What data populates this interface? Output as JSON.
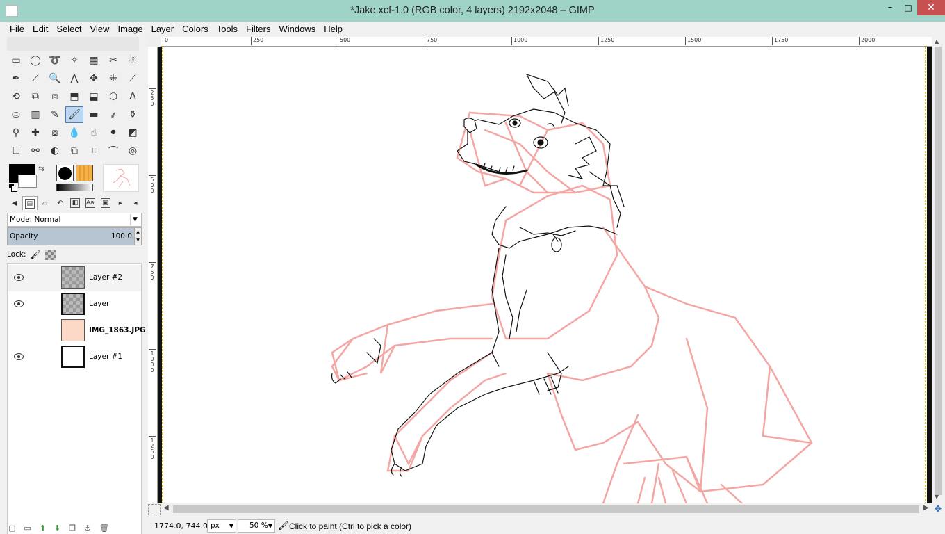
{
  "window": {
    "title": "*Jake.xcf-1.0 (RGB color, 4 layers) 2192x2048 – GIMP",
    "controls": {
      "minimize": "–",
      "maximize": "□",
      "close": "✕"
    }
  },
  "menu": [
    "File",
    "Edit",
    "Select",
    "View",
    "Image",
    "Layer",
    "Colors",
    "Tools",
    "Filters",
    "Windows",
    "Help"
  ],
  "toolbox": {
    "tools": [
      {
        "name": "rect-select-icon",
        "glyph": "▭"
      },
      {
        "name": "ellipse-select-icon",
        "glyph": "◯"
      },
      {
        "name": "free-select-icon",
        "glyph": "➰"
      },
      {
        "name": "fuzzy-select-icon",
        "glyph": "✧"
      },
      {
        "name": "color-select-icon",
        "glyph": "▦"
      },
      {
        "name": "scissors-select-icon",
        "glyph": "✂"
      },
      {
        "name": "foreground-select-icon",
        "glyph": "☃"
      },
      {
        "name": "paths-icon",
        "glyph": "✒"
      },
      {
        "name": "color-picker-icon",
        "glyph": "⟋"
      },
      {
        "name": "zoom-icon",
        "glyph": "🔍"
      },
      {
        "name": "measure-icon",
        "glyph": "⋀"
      },
      {
        "name": "move-icon",
        "glyph": "✥"
      },
      {
        "name": "align-icon",
        "glyph": "⁜"
      },
      {
        "name": "crop-icon",
        "glyph": "⟋"
      },
      {
        "name": "rotate-icon",
        "glyph": "⟲"
      },
      {
        "name": "scale-icon",
        "glyph": "⧉"
      },
      {
        "name": "shear-icon",
        "glyph": "⧈"
      },
      {
        "name": "perspective-icon",
        "glyph": "⬒"
      },
      {
        "name": "flip-icon",
        "glyph": "⬓"
      },
      {
        "name": "cage-icon",
        "glyph": "⬡"
      },
      {
        "name": "text-icon",
        "glyph": "A"
      },
      {
        "name": "bucket-fill-icon",
        "glyph": "⛀"
      },
      {
        "name": "blend-icon",
        "glyph": "▥"
      },
      {
        "name": "pencil-icon",
        "glyph": "✎"
      },
      {
        "name": "paintbrush-icon",
        "glyph": "🖌"
      },
      {
        "name": "eraser-icon",
        "glyph": "▬"
      },
      {
        "name": "airbrush-icon",
        "glyph": "⸙"
      },
      {
        "name": "ink-icon",
        "glyph": "⚱"
      },
      {
        "name": "clone-icon",
        "glyph": "⚲"
      },
      {
        "name": "heal-icon",
        "glyph": "✚"
      },
      {
        "name": "perspective-clone-icon",
        "glyph": "⧇"
      },
      {
        "name": "blur-icon",
        "glyph": "💧"
      },
      {
        "name": "smudge-icon",
        "glyph": "☝"
      },
      {
        "name": "dodge-burn-icon",
        "glyph": "⚫"
      },
      {
        "name": "unified-transform-icon",
        "glyph": "◩"
      },
      {
        "name": "handle-transform-icon",
        "glyph": "⧠"
      },
      {
        "name": "warp-icon",
        "glyph": "⚯"
      },
      {
        "name": "mypaint-icon",
        "glyph": "◐"
      },
      {
        "name": "seamless-clone-icon",
        "glyph": "⧉"
      },
      {
        "name": "n-point-deform-icon",
        "glyph": "⌗"
      },
      {
        "name": "curves-icon",
        "glyph": "⌒"
      },
      {
        "name": "gegl-icon",
        "glyph": "◎"
      }
    ]
  },
  "layers_panel": {
    "mode_label": "Mode: Normal",
    "opacity_label": "Opacity",
    "opacity_value": "100.0",
    "lock_label": "Lock:",
    "layers": [
      {
        "name": "Layer #2",
        "visible": true,
        "thumb": "checker",
        "selected": true,
        "bold": false
      },
      {
        "name": "Layer",
        "visible": true,
        "thumb": "checker-sel",
        "selected": false,
        "bold": false
      },
      {
        "name": "IMG_1863.JPG",
        "visible": false,
        "thumb": "photo",
        "selected": false,
        "bold": true
      },
      {
        "name": "Layer #1",
        "visible": true,
        "thumb": "white",
        "selected": false,
        "bold": false
      }
    ]
  },
  "rulers": {
    "h_ticks": [
      "0",
      "250",
      "500",
      "750",
      "1000",
      "1250",
      "1500",
      "1750",
      "2000"
    ],
    "v_ticks": [
      "250",
      "500",
      "750",
      "1000",
      "1250"
    ]
  },
  "status": {
    "coords": "1774.0, 744.0",
    "unit": "px",
    "zoom": "50 %",
    "message": "Click to paint (Ctrl to pick a color)"
  },
  "colors": {
    "titlebar": "#9fd3c7",
    "sketch_pink": "#f4a6a3",
    "ink": "#111111",
    "close_button": "#c75050"
  }
}
